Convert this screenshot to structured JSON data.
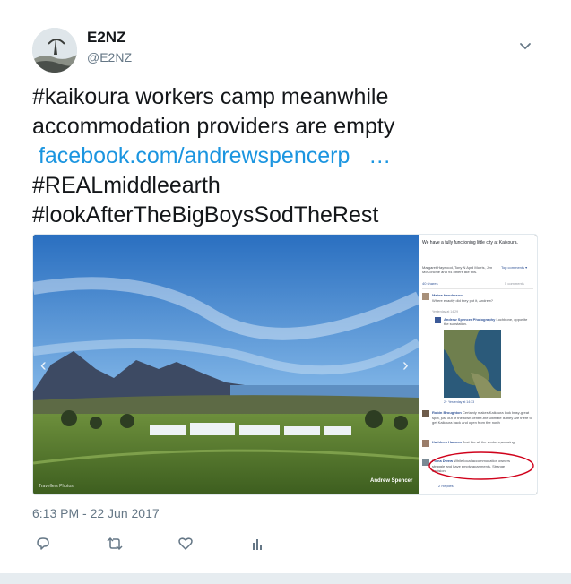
{
  "user": {
    "name": "E2NZ",
    "handle": "@E2NZ"
  },
  "tweet": {
    "line1": "#kaikoura workers camp meanwhile",
    "line2": "accommodation providers are empty",
    "link": "facebook.com/andrewspencerp",
    "ellipsis": "…",
    "line4": "#REALmiddleearth",
    "line5": "#lookAfterTheBigBoysSodTheRest"
  },
  "media": {
    "photo_credit": "Andrew Spencer",
    "watermark_left": "Travellers Photos",
    "fb": {
      "post": "We have a fully functioning little city at Kaikoura.",
      "likes": "Margaret Haywood, Tony N April Morris, Jen McConchie and 94 others like this.",
      "top_comments": "Top comments ▾",
      "shares": "40 shares",
      "comments_count": "5 comments",
      "c1_name": "Mahra Henderson",
      "c1_text": "Where exactly did they put it, Andrew?",
      "c1_meta": "Yesterday at 14:29",
      "r1_name": "Andrew Spencer Photography",
      "r1_text": "Lochbone, opposite the substation.",
      "r1_meta": "2 · Yesterday at 14:33",
      "c2_name": "Robin Broughton",
      "c2_text": "Certainly makes Kaikoura look busy-great spot, just out of the town centre-the ultimate is they are there to get Kaikoura back and open from the north",
      "c3_name": "Kathleen Harmon",
      "c3_text": "Just like all the workers,amazing",
      "c4_name": "Fiona Dwew",
      "c4_text": "While local accommodation owners struggle and have empty apartments. Strange decision.",
      "replies": "2 Replies"
    }
  },
  "timestamp": "6:13 PM - 22 Jun 2017",
  "icons": [
    "reply-icon",
    "retweet-icon",
    "like-icon",
    "analytics-icon",
    "chevron-down-icon"
  ],
  "colors": {
    "link": "#1b95e0",
    "muted": "#657786",
    "text": "#14171a"
  }
}
